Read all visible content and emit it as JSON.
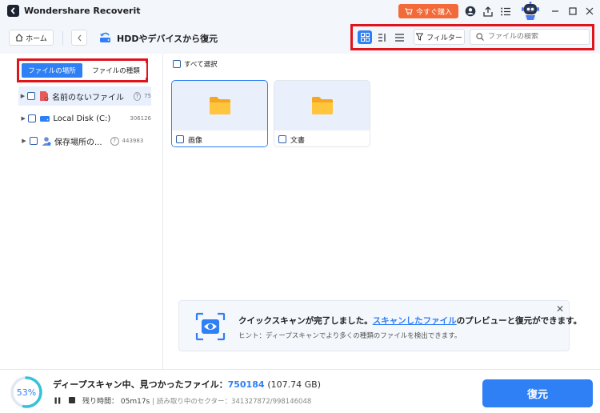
{
  "app": {
    "title": "Wondershare Recoverit",
    "buy_label": "今すぐ購入"
  },
  "toolbar": {
    "home_label": "ホーム",
    "location_title": "HDDやデバイスから復元",
    "filter_label": "フィルター",
    "search_placeholder": "ファイルの検索"
  },
  "sidebar": {
    "tabs": [
      {
        "label": "ファイルの場所",
        "active": true
      },
      {
        "label": "ファイルの種類",
        "active": false
      }
    ],
    "tree": [
      {
        "label": "名前のないファイル",
        "count": "75",
        "icon": "unnamed-file-icon",
        "has_help": true,
        "selected": true
      },
      {
        "label": "Local Disk (C:)",
        "count": "306126",
        "icon": "disk-icon",
        "has_help": false,
        "selected": false
      },
      {
        "label": "保存場所の...",
        "count": "443983",
        "icon": "user-location-icon",
        "has_help": true,
        "selected": false
      }
    ]
  },
  "main": {
    "select_all_label": "すべて選択",
    "folders": [
      {
        "label": "画像",
        "selected": true
      },
      {
        "label": "文書",
        "selected": false
      }
    ]
  },
  "notice": {
    "title_prefix": "クイックスキャンが完了しました。",
    "title_link": "スキャンしたファイル",
    "title_suffix": "のプレビューと復元ができます。",
    "hint": "ヒント：ディープスキャンでより多くの種類のファイルを検出できます。"
  },
  "status": {
    "progress_label": "53%",
    "progress_value": 0.53,
    "title_prefix": "ディープスキャン中、見つかったファイル：",
    "file_count": "750184",
    "total_size": "(107.74 GB)",
    "remaining_label": "残り時間：",
    "remaining_value": "05m17s",
    "sector_label": "読み取り中のセクター：341327872/998146048",
    "recover_label": "復元"
  },
  "colors": {
    "accent": "#2f7ff5",
    "highlight": "#e0151c",
    "buy": "#f26a3a"
  }
}
